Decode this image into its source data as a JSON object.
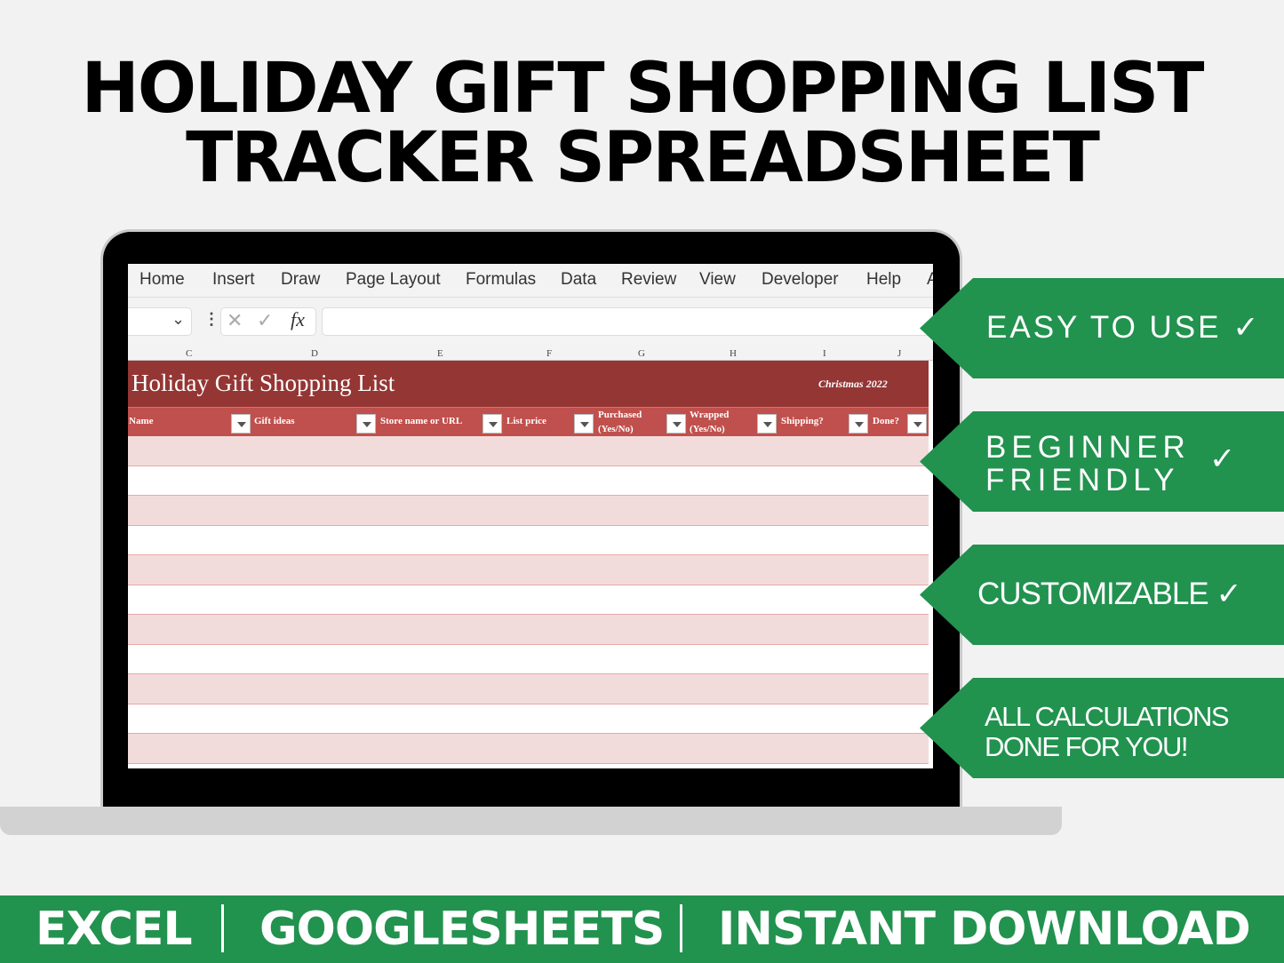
{
  "headline": {
    "line1": "HOLIDAY GIFT SHOPPING LIST",
    "line2": "TRACKER SPREADSHEET"
  },
  "ribbon": {
    "tabs": [
      "Home",
      "Insert",
      "Draw",
      "Page Layout",
      "Formulas",
      "Data",
      "Review",
      "View",
      "Developer",
      "Help",
      "A"
    ]
  },
  "formula_bar": {
    "fx_label": "fx",
    "cancel_icon": "x-icon",
    "confirm_icon": "check-icon",
    "value": ""
  },
  "columns": [
    "C",
    "D",
    "E",
    "F",
    "G",
    "H",
    "I",
    "J"
  ],
  "sheet": {
    "title": "Holiday Gift Shopping List",
    "subtitle": "Christmas  2022",
    "headers": [
      "Name",
      "Gift ideas",
      "Store name or URL",
      "List price",
      "Purchased (Yes/No)",
      "Wrapped (Yes/No)",
      "Shipping?",
      "Done?"
    ],
    "colors": {
      "title_band": "#943634",
      "header_row": "#c0504d",
      "band_row": "#f2dcdb"
    }
  },
  "features": [
    {
      "label": "EASY TO USE ✓"
    },
    {
      "label": "BEGINNER FRIENDLY",
      "check": "✓"
    },
    {
      "label": "CUSTOMIZABLE ✓"
    },
    {
      "label": "ALL CALCULATIONS DONE FOR YOU!"
    }
  ],
  "footer": {
    "items": [
      "EXCEL",
      "GOOGLESHEETS",
      "INSTANT DOWNLOAD"
    ],
    "color": "#22924f"
  }
}
